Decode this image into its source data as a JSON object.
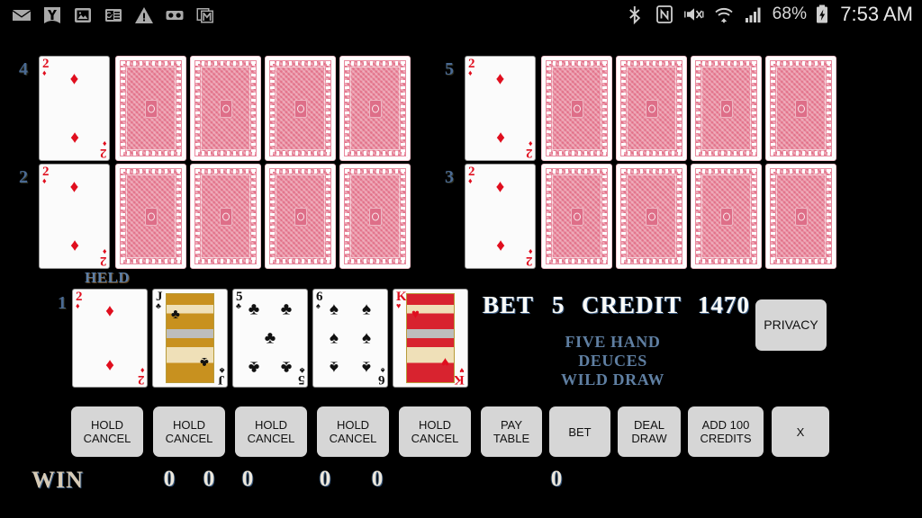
{
  "statusbar": {
    "left_icons": [
      "envelope-icon",
      "yahoo-icon",
      "photo-icon",
      "google-news-icon",
      "warning-icon",
      "voicemail-icon",
      "gmail-icon"
    ],
    "right_icons": [
      "bluetooth-icon",
      "nfc-icon",
      "vibrate-mute-icon",
      "wifi-icon",
      "cellular-signal-icon"
    ],
    "battery_percent": "68%",
    "battery_state": "charging",
    "time": "7:53 AM"
  },
  "game": {
    "title_lines": [
      "FIVE HAND",
      "DEUCES",
      "WILD DRAW"
    ],
    "bet_label": "BET",
    "bet_value": "5",
    "credit_label": "CREDIT",
    "credit_value": "1470",
    "held_label": "HELD",
    "privacy_label": "PRIVACY"
  },
  "hands": [
    {
      "number": "4",
      "cards": [
        {
          "type": "face",
          "rank": "2",
          "suit": "diamonds",
          "color": "red"
        },
        {
          "type": "back"
        },
        {
          "type": "back"
        },
        {
          "type": "back"
        },
        {
          "type": "back"
        }
      ]
    },
    {
      "number": "5",
      "cards": [
        {
          "type": "face",
          "rank": "2",
          "suit": "diamonds",
          "color": "red"
        },
        {
          "type": "back"
        },
        {
          "type": "back"
        },
        {
          "type": "back"
        },
        {
          "type": "back"
        }
      ]
    },
    {
      "number": "2",
      "cards": [
        {
          "type": "face",
          "rank": "2",
          "suit": "diamonds",
          "color": "red"
        },
        {
          "type": "back"
        },
        {
          "type": "back"
        },
        {
          "type": "back"
        },
        {
          "type": "back"
        }
      ]
    },
    {
      "number": "3",
      "cards": [
        {
          "type": "face",
          "rank": "2",
          "suit": "diamonds",
          "color": "red"
        },
        {
          "type": "back"
        },
        {
          "type": "back"
        },
        {
          "type": "back"
        },
        {
          "type": "back"
        }
      ]
    }
  ],
  "main_hand": {
    "number": "1",
    "cards": [
      {
        "rank": "2",
        "suit": "diamonds",
        "color": "red",
        "held": true
      },
      {
        "rank": "J",
        "suit": "clubs",
        "color": "black",
        "held": false
      },
      {
        "rank": "5",
        "suit": "clubs",
        "color": "black",
        "held": false
      },
      {
        "rank": "6",
        "suit": "spades",
        "color": "black",
        "held": false
      },
      {
        "rank": "K",
        "suit": "hearts",
        "color": "red",
        "held": false
      }
    ]
  },
  "hold_buttons": [
    {
      "line1": "HOLD",
      "line2": "CANCEL"
    },
    {
      "line1": "HOLD",
      "line2": "CANCEL"
    },
    {
      "line1": "HOLD",
      "line2": "CANCEL"
    },
    {
      "line1": "HOLD",
      "line2": "CANCEL"
    },
    {
      "line1": "HOLD",
      "line2": "CANCEL"
    }
  ],
  "action_buttons": [
    {
      "line1": "PAY",
      "line2": "TABLE"
    },
    {
      "line1": "BET",
      "line2": ""
    },
    {
      "line1": "DEAL",
      "line2": "DRAW"
    },
    {
      "line1": "ADD 100",
      "line2": "CREDITS"
    },
    {
      "line1": "X",
      "line2": ""
    }
  ],
  "win": {
    "label": "WIN",
    "values": [
      "0",
      "0",
      "0",
      "0",
      "0"
    ],
    "total": "0"
  }
}
